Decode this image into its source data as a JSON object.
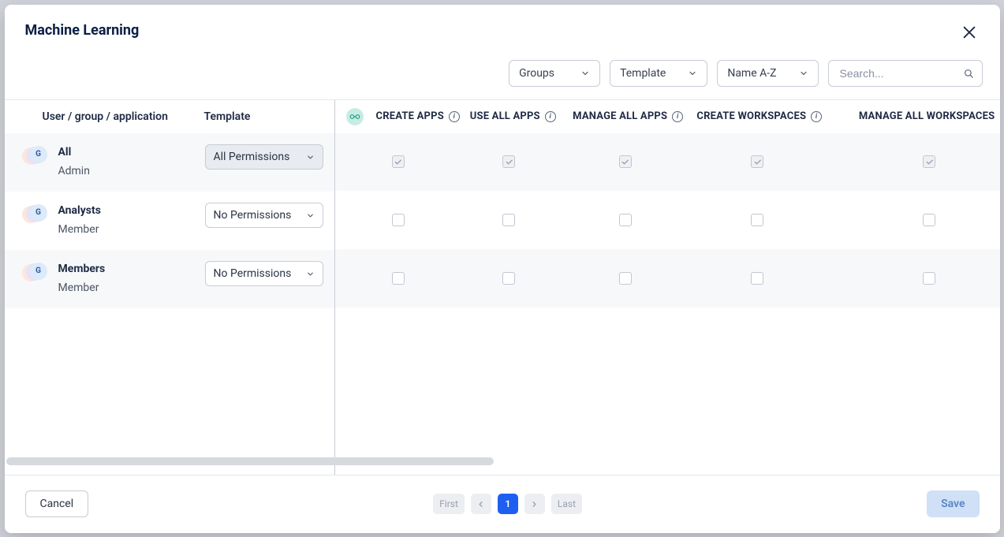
{
  "title": "Machine Learning",
  "toolbar": {
    "scope": "Groups",
    "template": "Template",
    "sort": "Name A-Z",
    "search_placeholder": "Search..."
  },
  "left_headers": {
    "user": "User / group / application",
    "template": "Template"
  },
  "permission_columns": [
    "CREATE APPS",
    "USE ALL APPS",
    "MANAGE ALL APPS",
    "CREATE WORKSPACES",
    "MANAGE ALL WORKSPACES"
  ],
  "rows": [
    {
      "avatar": "G",
      "name": "All",
      "role": "Admin",
      "template": "All Permissions",
      "template_filled": true,
      "checks": [
        true,
        true,
        true,
        true,
        true
      ]
    },
    {
      "avatar": "G",
      "name": "Analysts",
      "role": "Member",
      "template": "No Permissions",
      "template_filled": false,
      "checks": [
        false,
        false,
        false,
        false,
        false
      ]
    },
    {
      "avatar": "G",
      "name": "Members",
      "role": "Member",
      "template": "No Permissions",
      "template_filled": false,
      "checks": [
        false,
        false,
        false,
        false,
        false
      ]
    }
  ],
  "pager": {
    "first": "First",
    "last": "Last",
    "current": "1"
  },
  "footer": {
    "cancel": "Cancel",
    "save": "Save"
  }
}
